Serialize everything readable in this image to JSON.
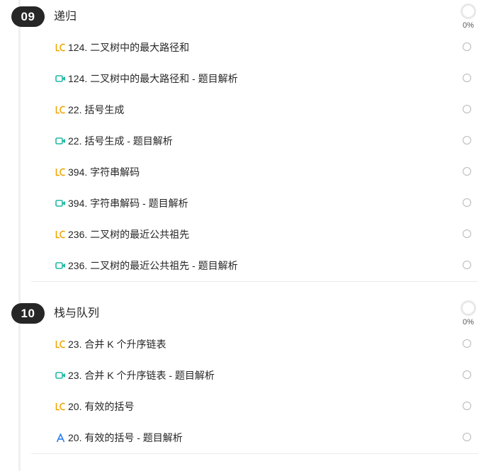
{
  "sections": [
    {
      "number": "09",
      "title": "递归",
      "progress": "0%",
      "items": [
        {
          "type": "leetcode",
          "icon": "leetcode-icon",
          "label": "124. 二叉树中的最大路径和"
        },
        {
          "type": "video",
          "icon": "video-icon",
          "label": "124. 二叉树中的最大路径和 - 题目解析"
        },
        {
          "type": "leetcode",
          "icon": "leetcode-icon",
          "label": "22. 括号生成"
        },
        {
          "type": "video",
          "icon": "video-icon",
          "label": "22. 括号生成 - 题目解析"
        },
        {
          "type": "leetcode",
          "icon": "leetcode-icon",
          "label": "394. 字符串解码"
        },
        {
          "type": "video",
          "icon": "video-icon",
          "label": "394. 字符串解码 - 题目解析"
        },
        {
          "type": "leetcode",
          "icon": "leetcode-icon",
          "label": "236. 二叉树的最近公共祖先"
        },
        {
          "type": "video",
          "icon": "video-icon",
          "label": "236. 二叉树的最近公共祖先 - 题目解析"
        }
      ]
    },
    {
      "number": "10",
      "title": "栈与队列",
      "progress": "0%",
      "items": [
        {
          "type": "leetcode",
          "icon": "leetcode-icon",
          "label": "23. 合并 K 个升序链表"
        },
        {
          "type": "video",
          "icon": "video-icon",
          "label": "23. 合并 K 个升序链表 - 题目解析"
        },
        {
          "type": "leetcode",
          "icon": "leetcode-icon",
          "label": "20. 有效的括号"
        },
        {
          "type": "article",
          "icon": "article-icon",
          "label": "20. 有效的括号 - 题目解析"
        }
      ]
    }
  ],
  "colors": {
    "leetcode": "#f0a500",
    "video": "#22b8a6",
    "article": "#2f7ff0",
    "badge_bg": "#262626",
    "check_border": "#b8b8b8"
  }
}
